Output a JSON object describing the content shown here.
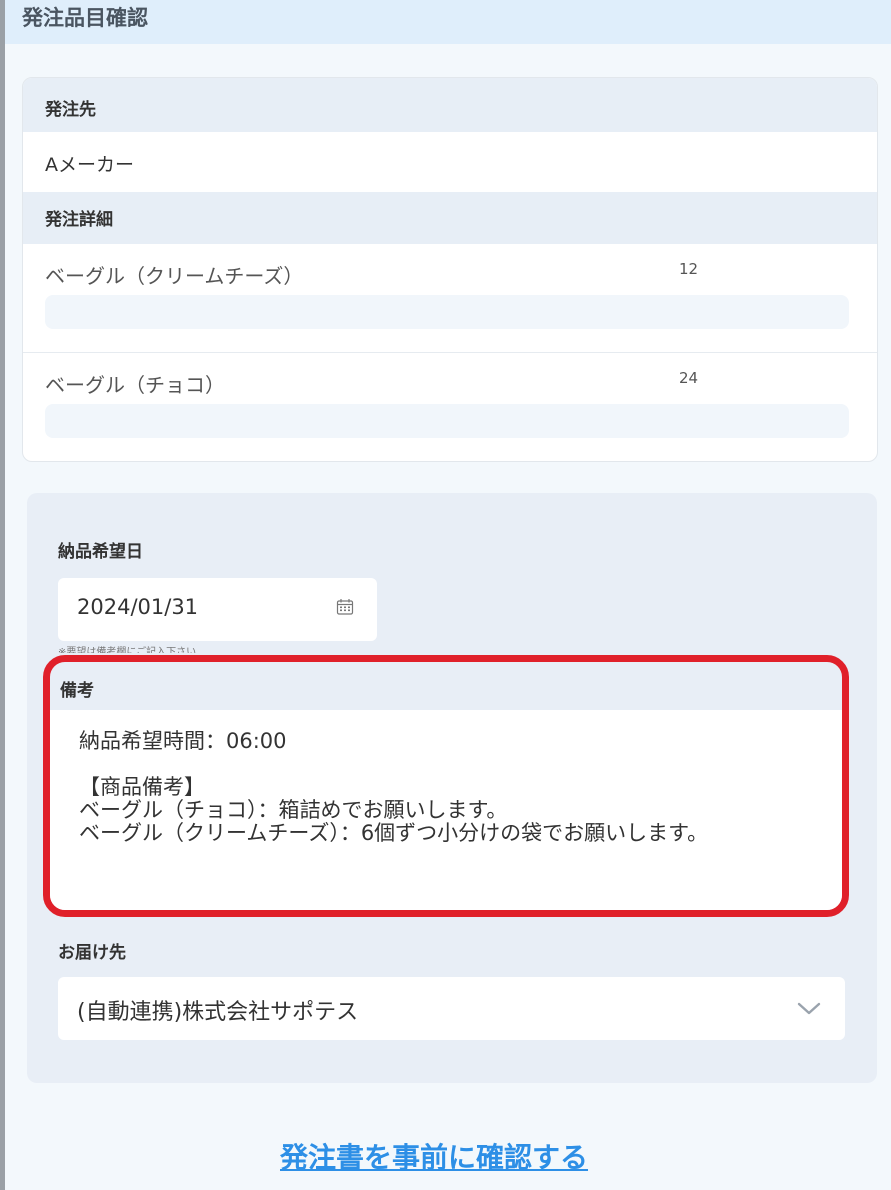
{
  "header": {
    "title": "発注品目確認"
  },
  "order": {
    "vendor_label": "発注先",
    "vendor_name": "Aメーカー",
    "details_label": "発注詳細",
    "items": [
      {
        "name": "ベーグル（クリームチーズ）",
        "quantity": "12"
      },
      {
        "name": "ベーグル（チョコ）",
        "quantity": "24"
      }
    ]
  },
  "delivery": {
    "date_label": "納品希望日",
    "date_value": "2024/01/31",
    "date_note": "※要望は備考欄にご記入下さい",
    "remarks_label": "備考",
    "remarks_text": "納品希望時間：06:00\n\n【商品備考】\nベーグル（チョコ）：箱詰めでお願いします。\nベーグル（クリームチーズ）：6個ずつ小分けの袋でお願いします。",
    "destination_label": "お届け先",
    "destination_value": "(自動連携)株式会社サポテス"
  },
  "actions": {
    "preview_link": "発注書を事前に確認する"
  },
  "colors": {
    "highlight": "#e0202a",
    "link": "#2d8fe6",
    "header_bg": "#dfeefb",
    "panel_bg": "#e8eef6"
  },
  "icons": [
    "calendar-icon",
    "chevron-down-icon"
  ]
}
